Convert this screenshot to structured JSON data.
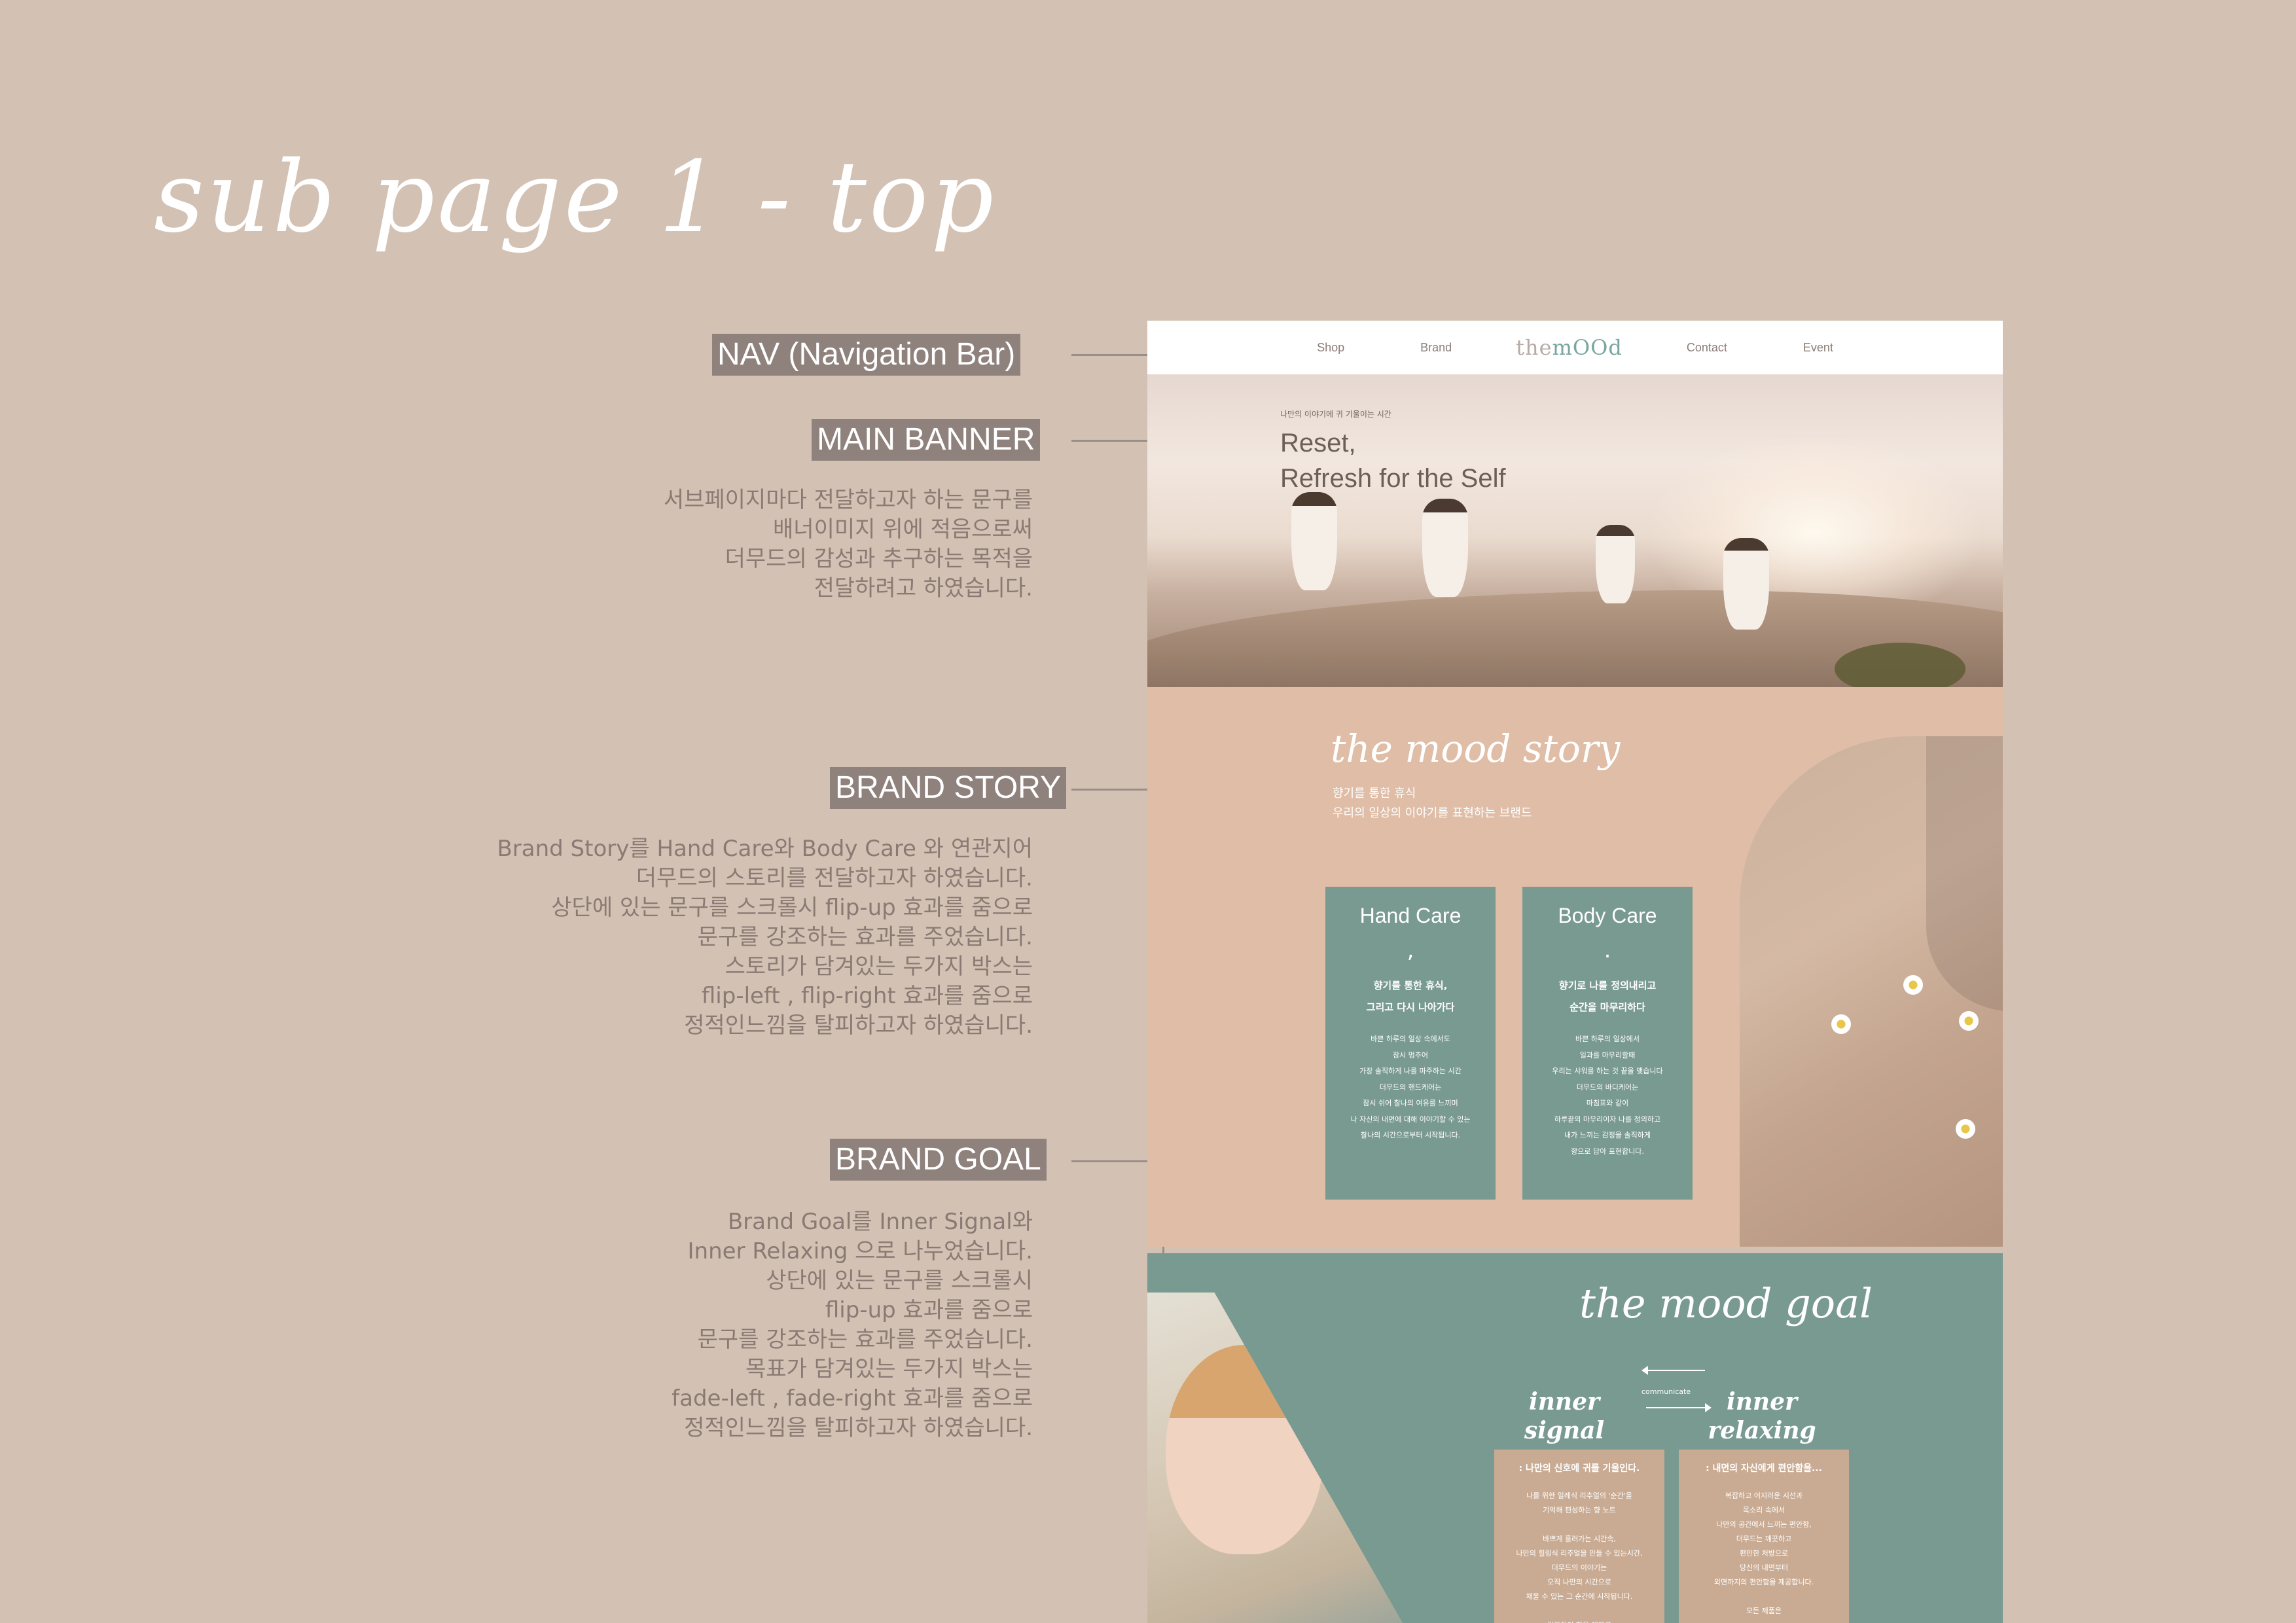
{
  "page_title": "sub page 1 - top",
  "annotations": {
    "nav": {
      "label": "NAV (Navigation Bar)"
    },
    "main_banner": {
      "label": "MAIN BANNER",
      "description": "서브페이지마다 전달하고자 하는 문구를\n배너이미지 위에 적음으로써\n더무드의 감성과 추구하는 목적을\n전달하려고 하였습니다."
    },
    "brand_story": {
      "label": "BRAND STORY",
      "description": "Brand Story를 Hand  Care와 Body Care 와 연관지어\n더무드의 스토리를 전달하고자 하였습니다.\n상단에 있는 문구를 스크롤시 flip-up 효과를 줌으로\n문구를 강조하는 효과를 주었습니다.\n스토리가 담겨있는 두가지 박스는\nflip-left , flip-right 효과를 줌으로\n정적인느낌을 탈피하고자 하였습니다."
    },
    "brand_goal": {
      "label": "BRAND GOAL",
      "description": "Brand Goal를 Inner Signal와\nInner Relaxing 으로 나누었습니다.\n상단에 있는 문구를 스크롤시\nflip-up 효과를 줌으로\n문구를 강조하는 효과를 주었습니다.\n목표가 담겨있는 두가지 박스는\nfade-left , fade-right 효과를 줌으로\n정적인느낌을 탈피하고자 하였습니다."
    }
  },
  "mockup": {
    "nav": {
      "items_left": [
        "Shop",
        "Brand"
      ],
      "logo_prefix": "the",
      "logo_main": "mOOd",
      "items_right": [
        "Contact",
        "Event"
      ]
    },
    "banner": {
      "small_text": "나만의 이야기에 귀 기울이는 시간",
      "title": "Reset,\nRefresh for the Self"
    },
    "story": {
      "title": "the mood story",
      "subtitle": "향기를 통한 휴식\n우리의 일상의 이야기를 표현하는 브랜드",
      "boxes": [
        {
          "title": "Hand Care",
          "mark": ",",
          "head": "향기를 통한 휴식,\n그리고 다시 나아가다",
          "body": "바쁜 하루의 일상 속에서도\n잠시 멈추어\n가장 솔직하게 나를 마주하는 시간\n더무드의 핸드케어는\n잠시 쉬어 찰나의 여유를 느끼며\n나 자신의 내면에 대해 이야기할 수 있는\n찰나의 시간으로부터 시작됩니다."
        },
        {
          "title": "Body Care",
          "mark": ".",
          "head": "향기로 나를 정의내리고\n순간을 마무리하다",
          "body": "바쁜 하루의 일상에서\n일과를 마무리할때\n우리는 샤워를 하는 것 끝을 맺습니다\n더무드의 바디케어는\n마침표와 같이\n하루끝의 마무리이자 나를 정의하고\n내가 느끼는 감정을 솔직하게\n향으로 담아 표현합니다."
        }
      ]
    },
    "goal": {
      "title": "the mood goal",
      "left_label": "inner\nsignal",
      "center_label": "communicate",
      "right_label": "inner\nrelaxing",
      "boxes": [
        {
          "head": ": 나만의 신호에 귀를 기울인다.",
          "body": "나를 위한 일례식 리추얼의 '순간'을\n기억해 편성하는 향 노트\n\n바쁘게 흘러가는 시간속,\n나만의 힐링식 리추얼을 만들 수 있는시간,\n더무드의 이야기는\n오직 나만의 시간으로\n채울 수 있는 그 순간에 시작됩니다.\n\n감각적인 향을 매개로\n나에게 집중하고 감각을 일깨워"
        },
        {
          "head": ": 내면의 자신에게 편안함을...",
          "body": "복잡하고 어지러운 시선과\n목소리 속에서\n나만의 공간에서 느끼는 편안함,\n더무드는 깨끗하고\n편안한 처방으로\n당신의 내면부터\n외면까지의 편안함을 제공합니다.\n\n모든 제품은"
        }
      ]
    }
  }
}
